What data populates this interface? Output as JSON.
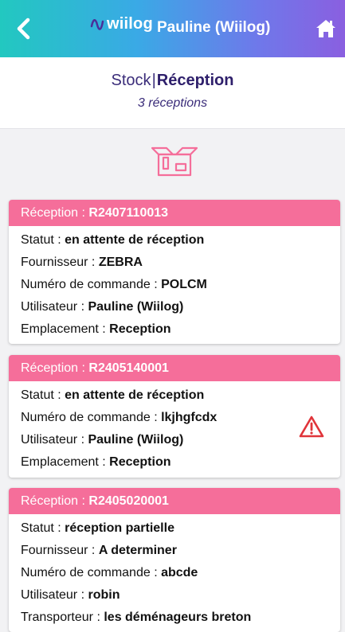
{
  "header": {
    "brand": "wiilog",
    "user": "Pauline (Wiilog)"
  },
  "page": {
    "breadcrumb_parent": "Stock",
    "breadcrumb_separator": "|",
    "breadcrumb_current": "Réception",
    "count_text": "3 réceptions"
  },
  "colors": {
    "card_header": "#f56e9a",
    "warning": "#e0343a",
    "title": "#2e1f6b"
  },
  "receptions": [
    {
      "label": "Réception : ",
      "code": "R2407110013",
      "warning": false,
      "fields": [
        {
          "key": "Statut : ",
          "value": "en attente de réception"
        },
        {
          "key": "Fournisseur : ",
          "value": "ZEBRA"
        },
        {
          "key": "Numéro de commande : ",
          "value": "POLCM"
        },
        {
          "key": "Utilisateur : ",
          "value": "Pauline (Wiilog)"
        },
        {
          "key": "Emplacement : ",
          "value": "Reception"
        }
      ]
    },
    {
      "label": "Réception : ",
      "code": "R2405140001",
      "warning": true,
      "fields": [
        {
          "key": "Statut : ",
          "value": "en attente de réception"
        },
        {
          "key": "Numéro de commande : ",
          "value": "lkjhgfcdx"
        },
        {
          "key": "Utilisateur : ",
          "value": "Pauline (Wiilog)"
        },
        {
          "key": "Emplacement : ",
          "value": "Reception"
        }
      ]
    },
    {
      "label": "Réception : ",
      "code": "R2405020001",
      "warning": false,
      "fields": [
        {
          "key": "Statut : ",
          "value": "réception partielle"
        },
        {
          "key": "Fournisseur : ",
          "value": "A determiner"
        },
        {
          "key": "Numéro de commande : ",
          "value": "abcde"
        },
        {
          "key": "Utilisateur : ",
          "value": "robin"
        },
        {
          "key": "Transporteur : ",
          "value": "les déménageurs breton"
        }
      ]
    }
  ]
}
